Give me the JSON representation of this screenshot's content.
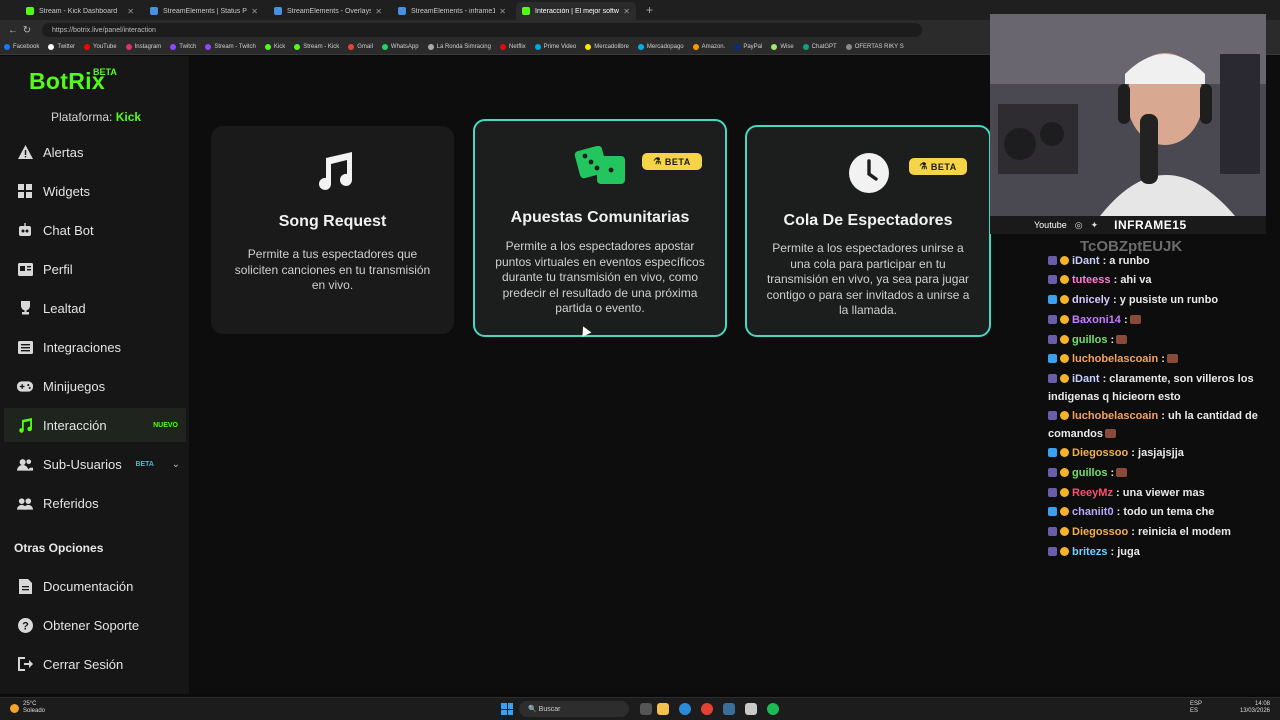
{
  "browser": {
    "tabs": [
      {
        "label": "Stream - Kick Dashboard",
        "color": "#53fc18"
      },
      {
        "label": "StreamElements | Status Page",
        "color": "#4a90e2"
      },
      {
        "label": "StreamElements - Overlays",
        "color": "#4a90e2"
      },
      {
        "label": "StreamElements - inframe15",
        "color": "#4a90e2"
      },
      {
        "label": "Interacción | El mejor software pa",
        "color": "#53fc18"
      }
    ],
    "url": "https://botrix.live/panel/interaction",
    "bookmarks": [
      {
        "label": "Facebook",
        "color": "#1877f2"
      },
      {
        "label": "Twitter",
        "color": "#ffffff"
      },
      {
        "label": "YouTube",
        "color": "#ff0000"
      },
      {
        "label": "Instagram",
        "color": "#e1306c"
      },
      {
        "label": "Twitch",
        "color": "#9146ff"
      },
      {
        "label": "Stream - Twitch",
        "color": "#9146ff"
      },
      {
        "label": "Kick",
        "color": "#53fc18"
      },
      {
        "label": "Stream - Kick",
        "color": "#53fc18"
      },
      {
        "label": "Gmail",
        "color": "#ea4335"
      },
      {
        "label": "WhatsApp",
        "color": "#25d366"
      },
      {
        "label": "La Ronda Simracing",
        "color": "#aaaaaa"
      },
      {
        "label": "Netflix",
        "color": "#e50914"
      },
      {
        "label": "Prime Video",
        "color": "#00a8e1"
      },
      {
        "label": "Mercadolibre",
        "color": "#ffe600"
      },
      {
        "label": "Mercadopago",
        "color": "#00b1ea"
      },
      {
        "label": "Amazon.",
        "color": "#ff9900"
      },
      {
        "label": "PayPal",
        "color": "#003087"
      },
      {
        "label": "Wise",
        "color": "#9fe870"
      },
      {
        "label": "ChatGPT",
        "color": "#10a37f"
      },
      {
        "label": "OFERTAS RIKY S",
        "color": "#888888"
      }
    ]
  },
  "sidebar": {
    "logo": "BotRix",
    "logo_badge": "BETA",
    "platform_label": "Plataforma:",
    "platform_value": "Kick",
    "items": [
      {
        "label": "Alertas",
        "icon": "alert-triangle-icon"
      },
      {
        "label": "Widgets",
        "icon": "grid-icon"
      },
      {
        "label": "Chat Bot",
        "icon": "robot-icon"
      },
      {
        "label": "Perfil",
        "icon": "id-card-icon"
      },
      {
        "label": "Lealtad",
        "icon": "trophy-icon"
      },
      {
        "label": "Integraciones",
        "icon": "list-icon"
      },
      {
        "label": "Minijuegos",
        "icon": "gamepad-icon"
      },
      {
        "label": "Interacción",
        "icon": "music-icon",
        "badge": "NUEVO"
      },
      {
        "label": "Sub-Usuarios",
        "icon": "users-icon",
        "badge": "BETA"
      },
      {
        "label": "Referidos",
        "icon": "user-group-icon"
      }
    ],
    "other_title": "Otras Opciones",
    "other_items": [
      {
        "label": "Documentación",
        "icon": "document-icon"
      },
      {
        "label": "Obtener Soporte",
        "icon": "help-icon"
      },
      {
        "label": "Cerrar Sesión",
        "icon": "logout-icon"
      }
    ]
  },
  "cards": [
    {
      "title": "Song Request",
      "description": "Permite a tus espectadores que soliciten canciones en tu transmisión en vivo.",
      "icon": "music-note-icon"
    },
    {
      "title": "Apuestas Comunitarias",
      "description": "Permite a los espectadores apostar puntos virtuales en eventos específicos durante tu transmisión en vivo, como predecir el resultado de una próxima partida o evento.",
      "icon": "dice-icon",
      "badge": "BETA"
    },
    {
      "title": "Cola De Espectadores",
      "description": "Permite a los espectadores unirse a una cola para participar en tu transmisión en vivo, ya sea para jugar contigo o para ser invitados a unirse a la llamada.",
      "icon": "clock-icon",
      "badge": "BETA"
    }
  ],
  "webcam": {
    "platform": "Youtube",
    "handle": "INFRAME15"
  },
  "chat": {
    "code": "TcOBZptEUJK",
    "messages": [
      {
        "user": "iDant",
        "text": ": a runbo",
        "color": "#c8d0ff"
      },
      {
        "user": "tuteess",
        "text": ": ahi va",
        "color": "#ff7ad9"
      },
      {
        "user": "dnicely",
        "text": ": y pusiste un runbo",
        "color": "#d8c8ff"
      },
      {
        "user": "Baxoni14",
        "text": ":",
        "color": "#c77dff"
      },
      {
        "user": "guillos",
        "text": ":",
        "color": "#72e06a"
      },
      {
        "user": "luchobelascoain",
        "text": ":",
        "color": "#f5a25d"
      },
      {
        "user": "iDant",
        "text": ": claramente, son villeros los indigenas q hicieorn esto",
        "color": "#c8d0ff"
      },
      {
        "user": "luchobelascoain",
        "text": ": uh la cantidad de comandos",
        "color": "#f5a25d"
      },
      {
        "user": "Diegossoo",
        "text": ": jasjajsjja",
        "color": "#f5b04a"
      },
      {
        "user": "guillos",
        "text": ":",
        "color": "#72e06a"
      },
      {
        "user": "ReeyMz",
        "text": ": una viewer mas",
        "color": "#ff4d6d"
      },
      {
        "user": "chaniit0",
        "text": ": todo un tema che",
        "color": "#b9a8ff"
      },
      {
        "user": "Diegossoo",
        "text": ": reinicia el modem",
        "color": "#f5b04a"
      },
      {
        "user": "britezs",
        "text": ": juga",
        "color": "#6ad3ff"
      }
    ]
  },
  "taskbar": {
    "weather_temp": "25°C",
    "weather_text": "Soleado",
    "search_placeholder": "Buscar",
    "lang_1": "ESP",
    "lang_2": "ES",
    "time": "14:08",
    "date": "13/03/2026"
  }
}
